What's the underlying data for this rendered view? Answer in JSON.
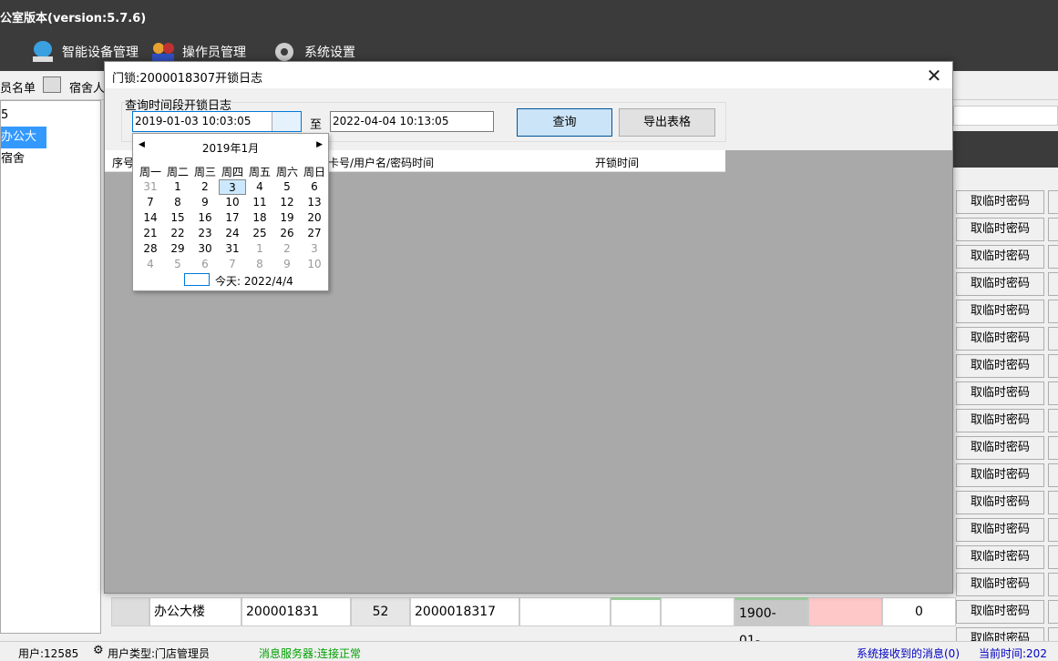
{
  "app": {
    "title": "公室版本(version:5.7.6)"
  },
  "toolbar": {
    "device_mgmt": "智能设备管理",
    "operator_mgmt": "操作员管理",
    "settings": "系统设置"
  },
  "subbar": {
    "tab_list": "员名单",
    "tab_dorm": "宿舍人"
  },
  "tree": {
    "items": [
      "5",
      "办公大楼",
      "宿舍"
    ]
  },
  "dialog": {
    "title": "门锁:2000018307开锁日志",
    "group_label": "查询时间段开锁日志",
    "from_value": "2019-01-03 10:03:05",
    "to_label": "至",
    "to_value": "2022-04-04 10:13:05",
    "query_btn": "查询",
    "export_btn": "导出表格",
    "grid_cols": [
      "序号",
      "",
      "卡号/用户名/密码时间",
      "开锁时间"
    ]
  },
  "calendar": {
    "month_label": "2019年1月",
    "weekdays": [
      "周一",
      "周二",
      "周三",
      "周四",
      "周五",
      "周六",
      "周日"
    ],
    "weeks": [
      [
        "31",
        "1",
        "2",
        "3",
        "4",
        "5",
        "6"
      ],
      [
        "7",
        "8",
        "9",
        "10",
        "11",
        "12",
        "13"
      ],
      [
        "14",
        "15",
        "16",
        "17",
        "18",
        "19",
        "20"
      ],
      [
        "21",
        "22",
        "23",
        "24",
        "25",
        "26",
        "27"
      ],
      [
        "28",
        "29",
        "30",
        "31",
        "1",
        "2",
        "3"
      ],
      [
        "4",
        "5",
        "6",
        "7",
        "8",
        "9",
        "10"
      ]
    ],
    "selected": "3",
    "today_label": "今天: 2022/4/4"
  },
  "right_buttons": {
    "label": "取临时密码"
  },
  "bottom_row": {
    "building": "办公大楼",
    "card": "200001831",
    "num": "52",
    "lock": "2000018317",
    "date": "1900-01-...",
    "count": "0"
  },
  "status": {
    "user": "用户:12585",
    "user_type": "用户类型:门店管理员",
    "server": "消息服务器:连接正常",
    "received": "系统接收到的消息(0)",
    "time": "当前时间:202"
  },
  "colors": {
    "titlebar": "#3b3b3b",
    "button": "#cce4f7",
    "grid_bg": "#a9a9a9",
    "selected_tree": "#3399ff"
  }
}
